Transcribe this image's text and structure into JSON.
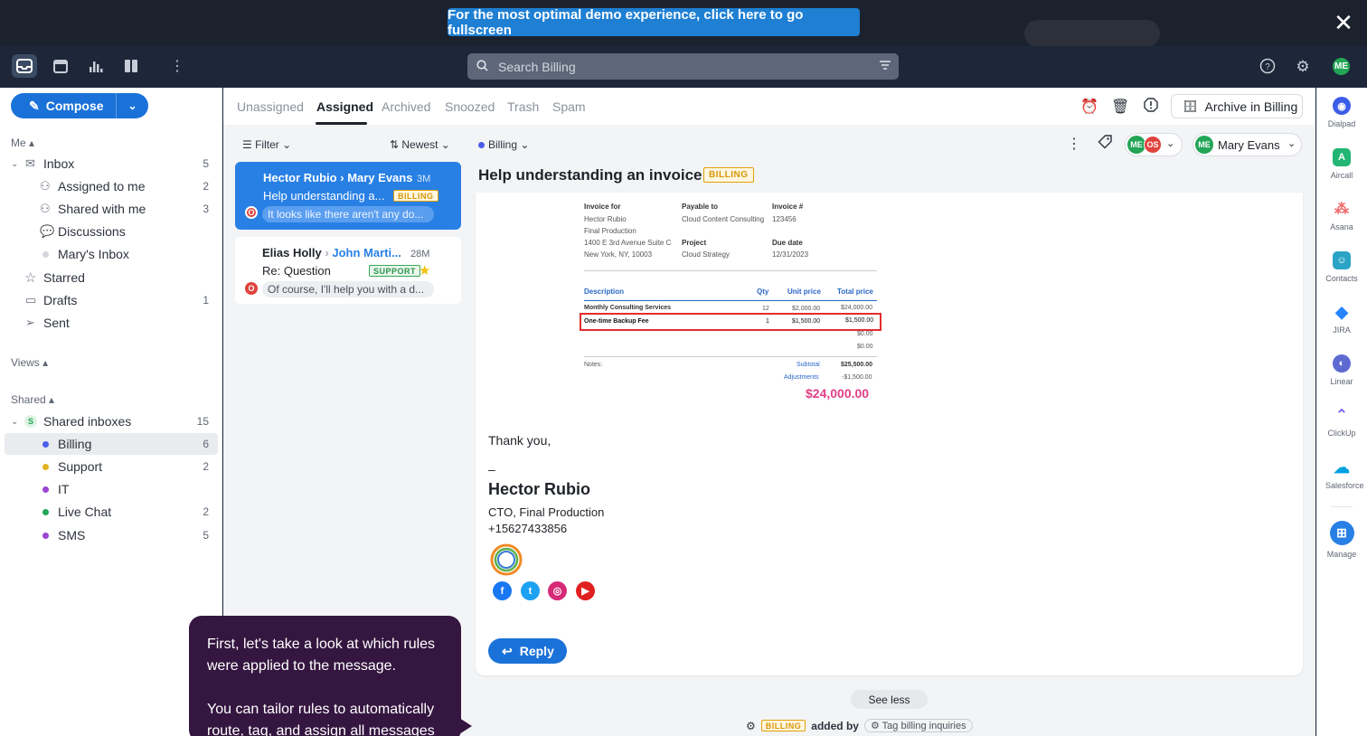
{
  "banner": {
    "text": "For the most optimal demo experience, click here to go fullscreen",
    "close": "✕"
  },
  "search": {
    "placeholder": "Search Billing"
  },
  "user": {
    "initials": "ME"
  },
  "compose": {
    "label": "Compose"
  },
  "sidebar": {
    "me_section": "Me ▴",
    "inbox": {
      "label": "Inbox",
      "count": "5"
    },
    "items": [
      {
        "label": "Assigned to me",
        "count": "2"
      },
      {
        "label": "Shared with me",
        "count": "3"
      },
      {
        "label": "Discussions",
        "count": ""
      },
      {
        "label": "Mary's Inbox",
        "count": ""
      },
      {
        "label": "Starred",
        "count": ""
      },
      {
        "label": "Drafts",
        "count": "1"
      },
      {
        "label": "Sent",
        "count": ""
      }
    ],
    "views_section": "Views ▴",
    "shared_section": "Shared ▴",
    "shared_inboxes": {
      "label": "Shared inboxes",
      "count": "15",
      "badge": "S"
    },
    "shared": [
      {
        "label": "Billing",
        "count": "6",
        "color": "#4a5ee8"
      },
      {
        "label": "Support",
        "count": "2",
        "color": "#e4b120"
      },
      {
        "label": "IT",
        "count": "",
        "color": "#9b45d3"
      },
      {
        "label": "Live Chat",
        "count": "2",
        "color": "#23a556"
      },
      {
        "label": "SMS",
        "count": "5",
        "color": "#9b45d3"
      }
    ]
  },
  "tabs": [
    "Unassigned",
    "Assigned",
    "Archived",
    "Snoozed",
    "Trash",
    "Spam"
  ],
  "archive_button": "Archive in Billing",
  "list": {
    "filter": "Filter",
    "sort": "Newest",
    "cards": [
      {
        "from": "Hector Rubio",
        "to": "Mary Evans",
        "time": "3M",
        "subject": "Help understanding a...",
        "tag": "BILLING",
        "preview": "It looks like there aren't any do..."
      },
      {
        "from": "Elias Holly",
        "to": "John Marti...",
        "time": "28M",
        "subject": "Re: Question",
        "tag": "SUPPORT",
        "preview": "Of course, I'll help you with a d..."
      }
    ]
  },
  "conversation": {
    "inbox": "Billing",
    "title": "Help understanding an invoice",
    "tag": "BILLING",
    "participants": [
      "ME",
      "OS"
    ],
    "assignee": {
      "initials": "ME",
      "name": "Mary Evans"
    },
    "invoice": {
      "invoice_for_label": "Invoice for",
      "invoice_for": [
        "Hector Rubio",
        "Final Production",
        "1400 E 3rd Avenue Suite C",
        "New York, NY, 10003"
      ],
      "payable_label": "Payable to",
      "payable": "Cloud Content Consulting",
      "project_label": "Project",
      "project": "Cloud Strategy",
      "invoice_no_label": "Invoice #",
      "invoice_no": "123456",
      "due_label": "Due date",
      "due": "12/31/2023",
      "headers": [
        "Description",
        "Qty",
        "Unit price",
        "Total price"
      ],
      "rows": [
        [
          "Monthly Consulting Services",
          "12",
          "$2,000.00",
          "$24,000.00"
        ],
        [
          "One-time Backup Fee",
          "1",
          "$1,500.00",
          "$1,500.00"
        ]
      ],
      "empty1": "$0.00",
      "empty2": "$0.00",
      "notes_label": "Notes:",
      "subtotal_label": "Subtotal",
      "subtotal": "$25,500.00",
      "adjust_label": "Adjustments",
      "adjust": "-$1,500.00",
      "total": "$24,000.00"
    },
    "thanks": "Thank you,",
    "dash": "–",
    "sig_name": "Hector Rubio",
    "sig_title": "CTO, Final Production",
    "sig_phone": "+15627433856",
    "reply": "Reply",
    "see_less": "See less",
    "activity": {
      "tag": "BILLING",
      "text": "added by",
      "rule": "Tag billing inquiries"
    }
  },
  "right_integrations": [
    "Dialpad",
    "Aircall",
    "Asana",
    "Contacts",
    "JIRA",
    "Linear",
    "ClickUp",
    "Salesforce",
    "Manage"
  ],
  "tooltip": {
    "p1": "First, let's take a look at which rules were applied to the message.",
    "p2": "You can tailor rules to automatically route, tag, and assign all messages"
  }
}
